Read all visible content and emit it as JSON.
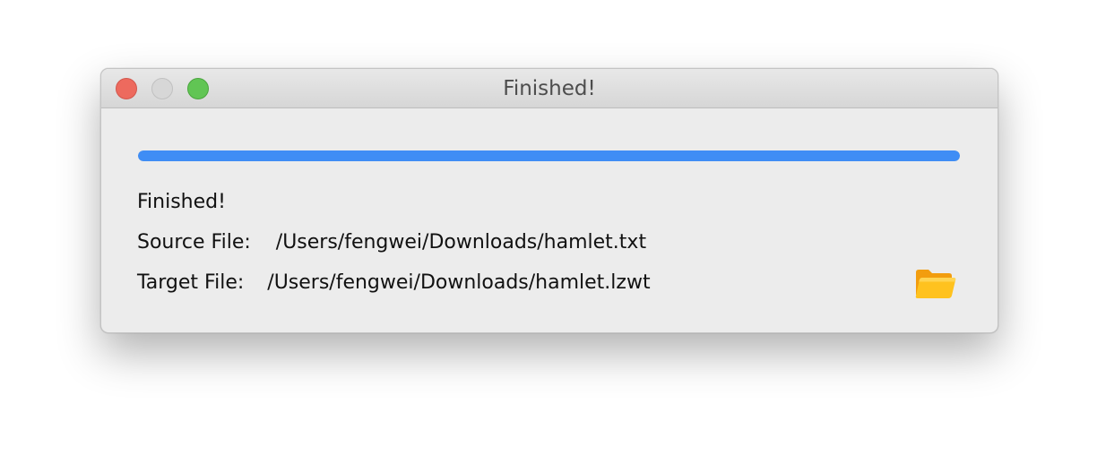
{
  "window": {
    "title": "Finished!"
  },
  "progress": {
    "value": 1.0,
    "fill_color": "#3f8df5"
  },
  "status_text": "Finished!",
  "source": {
    "label": "Source File:",
    "path": "/Users/fengwei/Downloads/hamlet.txt"
  },
  "target": {
    "label": "Target File:",
    "path": "/Users/fengwei/Downloads/hamlet.lzwt"
  },
  "icons": {
    "open_folder": "folder-open-icon"
  }
}
